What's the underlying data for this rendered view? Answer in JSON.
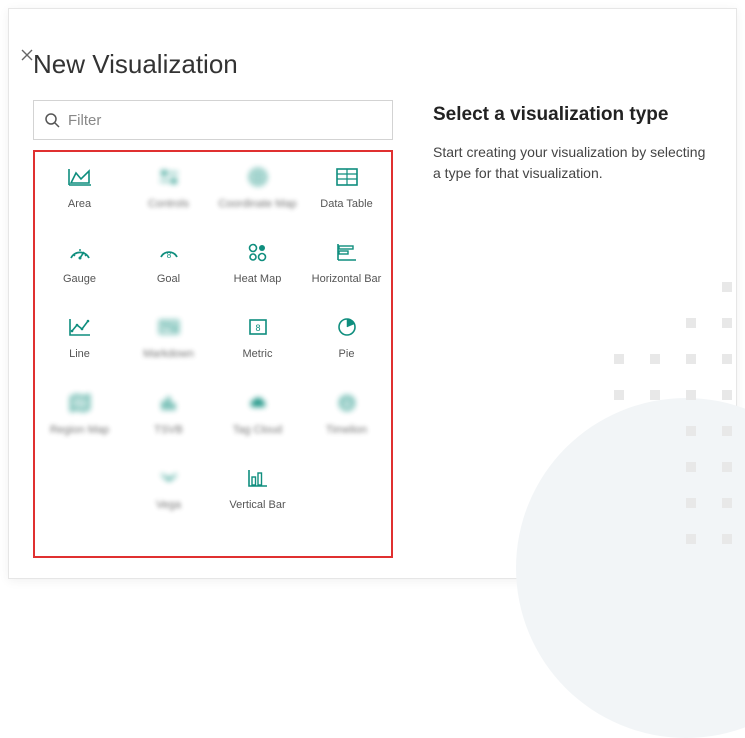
{
  "modal": {
    "title": "New Visualization"
  },
  "search": {
    "placeholder": "Filter"
  },
  "sidebar": {
    "heading": "Select a visualization type",
    "description": "Start creating your visualization by selecting a type for that visualization."
  },
  "tiles": {
    "area": "Area",
    "controls": "Controls",
    "coordinate_map": "Coordinate Map",
    "data_table": "Data Table",
    "gauge": "Gauge",
    "goal": "Goal",
    "heat_map": "Heat Map",
    "horizontal_bar": "Horizontal Bar",
    "line": "Line",
    "markdown": "Markdown",
    "metric": "Metric",
    "pie": "Pie",
    "region_map": "Region Map",
    "tsvb": "TSVB",
    "tag_cloud": "Tag Cloud",
    "timelion": "Timelion",
    "vega": "Vega",
    "vertical_bar": "Vertical Bar"
  }
}
